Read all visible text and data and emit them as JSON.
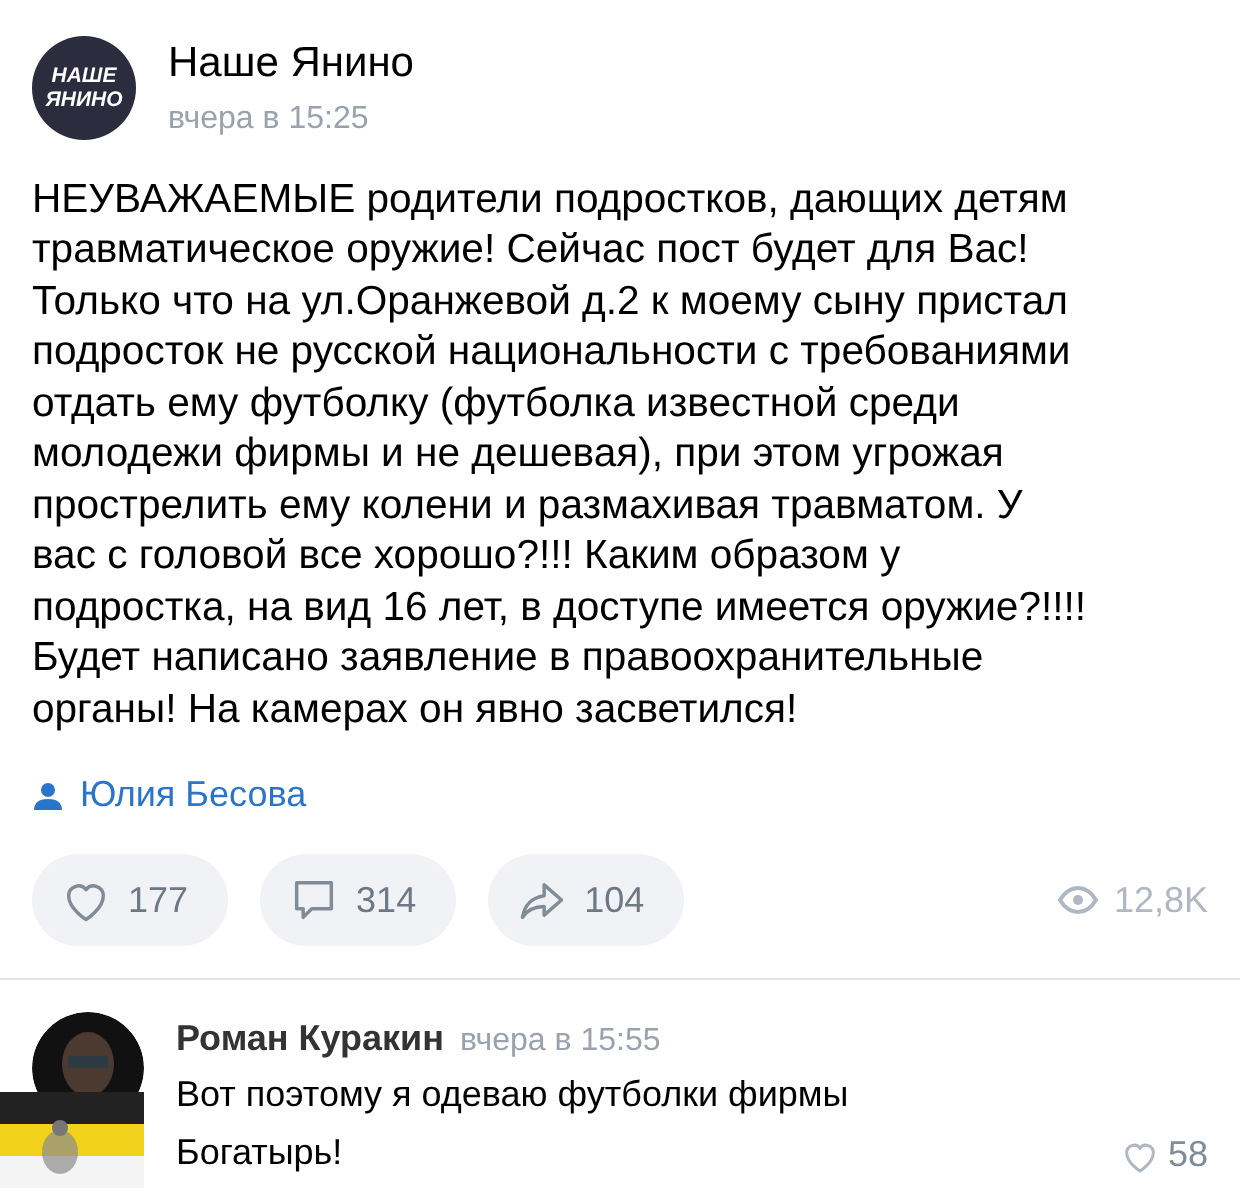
{
  "post": {
    "author": "Наше Янино",
    "time": "вчера в 15:25",
    "logo": {
      "line_1": "НАШЕ",
      "line_2": "ЯНИНО"
    },
    "text": "НЕУВАЖАЕМЫЕ родители подростков, дающих детям\nтравматическое оружие! Сейчас пост будет для Вас!\nТолько что на ул.Оранжевой д.2 к моему сыну пристал\nподросток не русской национальности с требованиями\nотдать ему футболку (футболка известной среди\nмолодежи фирмы и не дешевая), при этом угрожая\nпрострелить ему колени и размахивая травматом.   У\nвас с головой все хорошо?!!! Каким образом у\nподростка, на вид 16 лет, в доступе имеется оружие?!!!!\nБудет написано заявление в правоохранительные\nорганы! На камерах он явно засветился!",
    "signer": "Юлия Бесова",
    "actions": [
      {
        "kind": "like",
        "count": "177"
      },
      {
        "kind": "comment",
        "count": "314"
      },
      {
        "kind": "share",
        "count": "104"
      }
    ],
    "views": "12,8K"
  },
  "comment": {
    "author": "Роман Куракин",
    "time": "вчера в 15:55",
    "text": "Вот поэтому я одеваю  футболки фирмы\nБогатырь!",
    "likes": "58"
  }
}
